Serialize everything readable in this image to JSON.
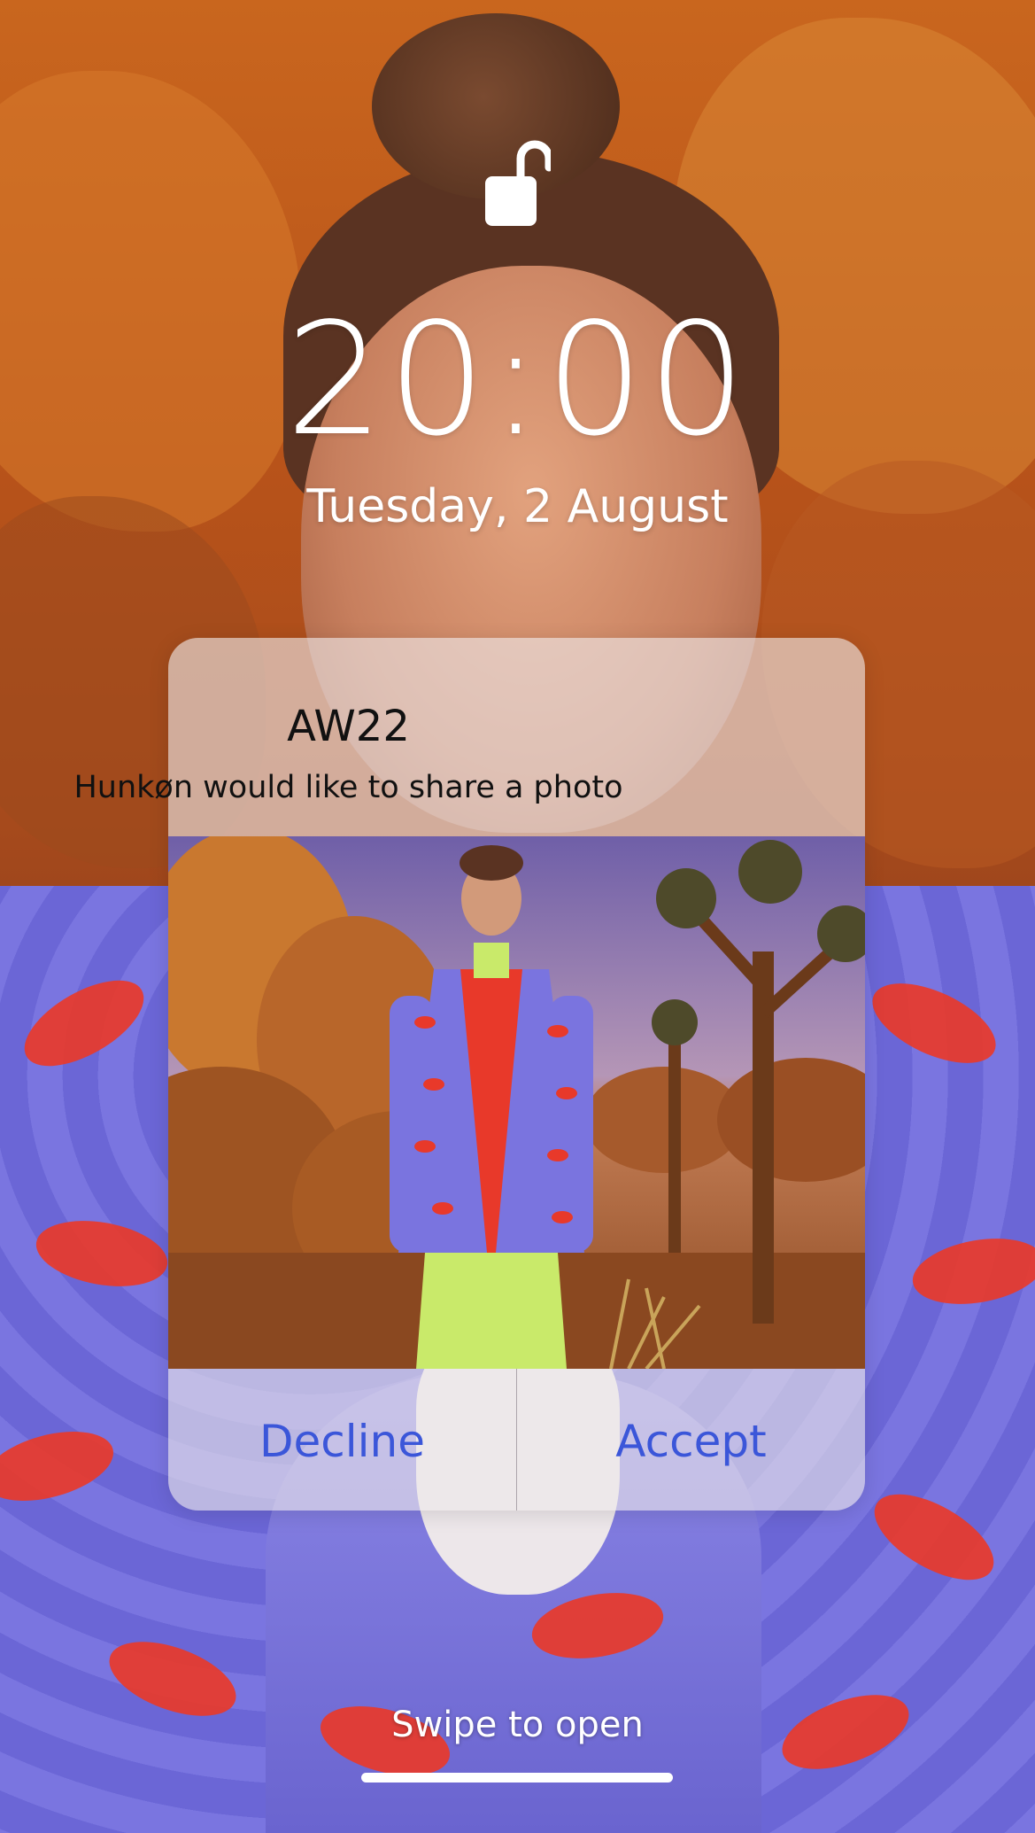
{
  "lock_screen": {
    "time": "20:00",
    "date": "Tuesday, 2 August",
    "lock_icon": "unlocked-padlock-icon"
  },
  "notification": {
    "title": "AW22",
    "message": "Hunkøn would like to share a photo",
    "decline_label": "Decline",
    "accept_label": "Accept",
    "button_color": "#3b56d9"
  },
  "footer": {
    "swipe_hint": "Swipe to open"
  }
}
